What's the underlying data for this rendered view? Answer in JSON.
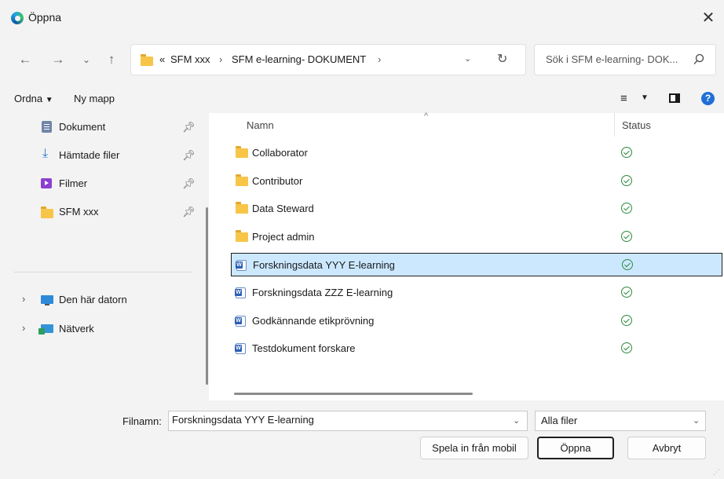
{
  "window": {
    "title": "Öppna"
  },
  "nav": {
    "breadcrumb_prefix": "«",
    "breadcrumbs": [
      "SFM xxx",
      "SFM e-learning- DOKUMENT"
    ],
    "search_placeholder": "Sök i SFM e-learning- DOK..."
  },
  "toolbar": {
    "organize_label": "Ordna",
    "new_folder_label": "Ny mapp"
  },
  "sidebar": {
    "quick_access": [
      {
        "label": "Dokument",
        "icon": "documents-icon"
      },
      {
        "label": "Hämtade filer",
        "icon": "downloads-icon"
      },
      {
        "label": "Filmer",
        "icon": "videos-icon"
      },
      {
        "label": "SFM xxx",
        "icon": "folder-icon"
      }
    ],
    "locations": [
      {
        "label": "Den här datorn",
        "icon": "computer-icon"
      },
      {
        "label": "Nätverk",
        "icon": "network-icon"
      }
    ]
  },
  "filelist": {
    "columns": {
      "name": "Namn",
      "status": "Status"
    },
    "rows": [
      {
        "name": "Collaborator",
        "type": "folder",
        "selected": false
      },
      {
        "name": "Contributor",
        "type": "folder",
        "selected": false
      },
      {
        "name": "Data Steward",
        "type": "folder",
        "selected": false
      },
      {
        "name": "Project admin",
        "type": "folder",
        "selected": false
      },
      {
        "name": "Forskningsdata YYY E-learning",
        "type": "word",
        "selected": true
      },
      {
        "name": "Forskningsdata ZZZ E-learning",
        "type": "word",
        "selected": false
      },
      {
        "name": "Godkännande etikprövning",
        "type": "word",
        "selected": false
      },
      {
        "name": "Testdokument forskare",
        "type": "word",
        "selected": false
      }
    ]
  },
  "footer": {
    "filename_label": "Filnamn:",
    "filename_value": "Forskningsdata YYY E-learning",
    "filetype_value": "Alla filer",
    "record_button": "Spela in från mobil",
    "open_button": "Öppna",
    "cancel_button": "Avbryt"
  },
  "colors": {
    "selection": "#cce8ff",
    "folder": "#f7c548",
    "status_ok": "#2d8a3e",
    "chrome": "#f3f3f3"
  }
}
